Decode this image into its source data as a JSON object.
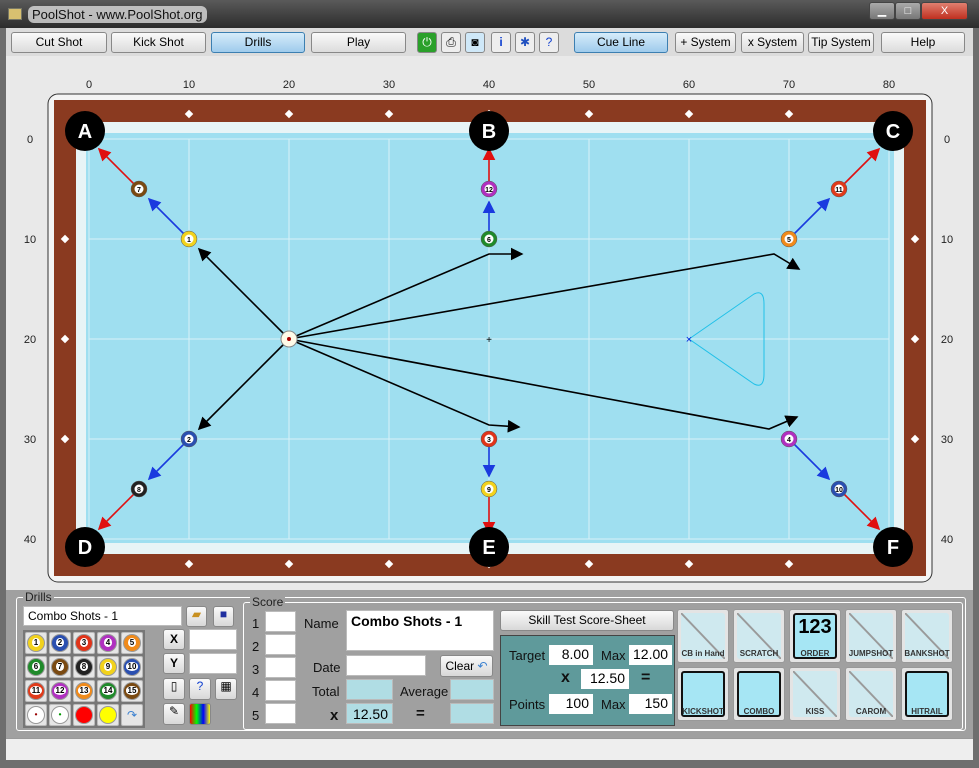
{
  "window": {
    "title": "PoolShot - www.PoolShot.org",
    "minimize": "▁",
    "maximize": "□",
    "close": "X"
  },
  "toolbar": {
    "cut_shot": "Cut Shot",
    "kick_shot": "Kick Shot",
    "drills": "Drills",
    "play": "Play",
    "cue_line": "Cue Line",
    "plus_system": "+ System",
    "x_system": "x System",
    "tip_system": "Tip System",
    "help": "Help",
    "icons": [
      "power-icon",
      "print-icon",
      "camera-icon",
      "info-icon",
      "settings-icon",
      "help-doc-icon"
    ]
  },
  "table": {
    "x_ticks": [
      "0",
      "10",
      "20",
      "30",
      "40",
      "50",
      "60",
      "70",
      "80"
    ],
    "y_ticks": [
      "0",
      "10",
      "20",
      "30",
      "40"
    ],
    "pockets": [
      {
        "label": "A",
        "x": 0,
        "y": 0
      },
      {
        "label": "B",
        "x": 40,
        "y": 0
      },
      {
        "label": "C",
        "x": 80,
        "y": 0
      },
      {
        "label": "D",
        "x": 0,
        "y": 40
      },
      {
        "label": "E",
        "x": 40,
        "y": 40
      },
      {
        "label": "F",
        "x": 80,
        "y": 40
      }
    ],
    "cue_ball": {
      "x": 20,
      "y": 20
    },
    "balls": [
      {
        "n": "7",
        "x": 5,
        "y": 5,
        "color": "#7a4a12"
      },
      {
        "n": "1",
        "x": 10,
        "y": 10,
        "color": "#f2d21c"
      },
      {
        "n": "12",
        "x": 40,
        "y": 5,
        "color": "#b030c0"
      },
      {
        "n": "6",
        "x": 40,
        "y": 10,
        "color": "#1f8a2a"
      },
      {
        "n": "11",
        "x": 75,
        "y": 5,
        "color": "#e03a1a"
      },
      {
        "n": "5",
        "x": 70,
        "y": 10,
        "color": "#f08a1a"
      },
      {
        "n": "2",
        "x": 10,
        "y": 30,
        "color": "#2a4fb0"
      },
      {
        "n": "8",
        "x": 5,
        "y": 35,
        "color": "#222222"
      },
      {
        "n": "3",
        "x": 40,
        "y": 30,
        "color": "#e0341a"
      },
      {
        "n": "9",
        "x": 40,
        "y": 35,
        "color": "#f2d21c"
      },
      {
        "n": "4",
        "x": 70,
        "y": 30,
        "color": "#b030c0"
      },
      {
        "n": "10",
        "x": 75,
        "y": 35,
        "color": "#2a4fb0"
      }
    ],
    "cue_paths": [
      [
        [
          20,
          20
        ],
        [
          11,
          11
        ]
      ],
      [
        [
          20,
          20
        ],
        [
          40,
          11.5
        ],
        [
          43.3,
          11.5
        ]
      ],
      [
        [
          20,
          20
        ],
        [
          68.5,
          11.5
        ],
        [
          71,
          13
        ]
      ],
      [
        [
          20,
          20
        ],
        [
          11,
          29
        ]
      ],
      [
        [
          20,
          20
        ],
        [
          40,
          28.6
        ],
        [
          43,
          28.8
        ]
      ],
      [
        [
          20,
          20
        ],
        [
          68,
          29
        ],
        [
          70.8,
          27.8
        ]
      ]
    ],
    "combo_paths": [
      [
        [
          10,
          10
        ],
        [
          6,
          6
        ]
      ],
      [
        [
          40,
          10
        ],
        [
          40,
          6.3
        ]
      ],
      [
        [
          70,
          10
        ],
        [
          74,
          6
        ]
      ],
      [
        [
          10,
          30
        ],
        [
          6,
          34
        ]
      ],
      [
        [
          40,
          30
        ],
        [
          40,
          33.7
        ]
      ],
      [
        [
          70,
          30
        ],
        [
          74,
          34
        ]
      ]
    ],
    "pocket_paths": [
      [
        [
          5,
          5
        ],
        [
          1,
          1
        ]
      ],
      [
        [
          40,
          5
        ],
        [
          40,
          1
        ]
      ],
      [
        [
          75,
          5
        ],
        [
          79,
          1
        ]
      ],
      [
        [
          5,
          35
        ],
        [
          1,
          39
        ]
      ],
      [
        [
          40,
          35
        ],
        [
          40,
          39.4
        ]
      ],
      [
        [
          75,
          35
        ],
        [
          79,
          39
        ]
      ]
    ],
    "rack": {
      "x": 60,
      "y": 20
    },
    "colors": {
      "cloth": "#9fdff0",
      "rail": "#8a3a20",
      "cue_line": "#000000",
      "combo_line": "#1a3adf",
      "pocket_line": "#e01010",
      "rack": "#20c0e8"
    }
  },
  "drills": {
    "legend": "Drills",
    "name": "Combo Shots - 1",
    "x_label": "X",
    "y_label": "Y",
    "x_value": "",
    "y_value": ""
  },
  "score": {
    "legend": "Score",
    "rows": [
      "1",
      "2",
      "3",
      "4",
      "5"
    ],
    "name_label": "Name",
    "name_value": "Combo Shots - 1",
    "date_label": "Date",
    "clear": "Clear",
    "total_label": "Total",
    "average_label": "Average",
    "x_label": "x",
    "multiplier": "12.50",
    "equals": "="
  },
  "skill": {
    "button": "Skill Test Score-Sheet",
    "target_label": "Target",
    "target": "8.00",
    "max_label": "Max",
    "max_target": "12.00",
    "x_label": "x",
    "multiplier": "12.50",
    "equals": "=",
    "points_label": "Points",
    "points": "100",
    "max_points": "150"
  },
  "shot_types": [
    {
      "label": "CB in Hand",
      "on": false
    },
    {
      "label": "SCRATCH",
      "on": false
    },
    {
      "label": "ORDER",
      "on": true
    },
    {
      "label": "JUMPSHOT",
      "on": false
    },
    {
      "label": "BANKSHOT",
      "on": false
    },
    {
      "label": "KICKSHOT",
      "on": true
    },
    {
      "label": "COMBO",
      "on": true
    },
    {
      "label": "KISS",
      "on": false
    },
    {
      "label": "CAROM",
      "on": false
    },
    {
      "label": "HITRAIL",
      "on": true
    }
  ],
  "order_glyph": "123"
}
